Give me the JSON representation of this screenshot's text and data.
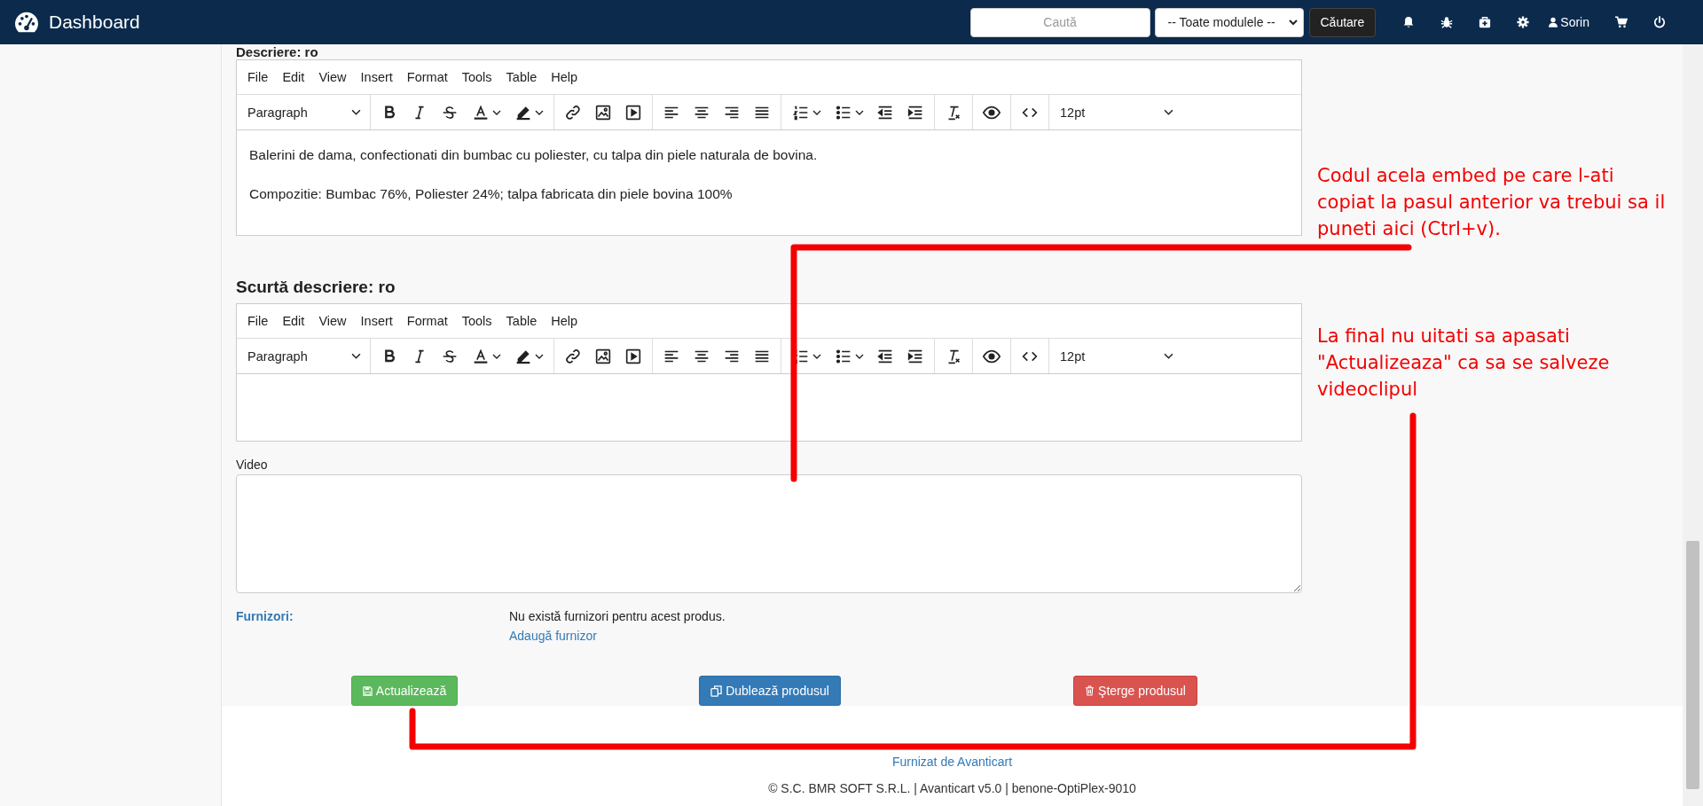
{
  "navbar": {
    "brand": "Dashboard",
    "search": {
      "placeholder": "Caută"
    },
    "module_select": {
      "value": "-- Toate modulele --"
    },
    "search_button": "Căutare",
    "user": "Sorin"
  },
  "editors": [
    {
      "heading": "Descriere: ro",
      "menu": [
        "File",
        "Edit",
        "View",
        "Insert",
        "Format",
        "Tools",
        "Table",
        "Help"
      ],
      "block_format": "Paragraph",
      "font_size": "12pt",
      "paragraphs": [
        "Balerini de dama, confectionati din bumbac cu poliester, cu talpa din piele naturala de bovina.",
        "Compozitie: Bumbac 76%, Poliester 24%; talpa fabricata din piele bovina 100%"
      ]
    },
    {
      "heading": "Scurtă descriere: ro",
      "menu": [
        "File",
        "Edit",
        "View",
        "Insert",
        "Format",
        "Tools",
        "Table",
        "Help"
      ],
      "block_format": "Paragraph",
      "font_size": "12pt"
    }
  ],
  "video": {
    "label": "Video"
  },
  "suppliers": {
    "label": "Furnizori:",
    "empty_text": "Nu există furnizori pentru acest produs.",
    "add_link": "Adaugă furnizor"
  },
  "actions": [
    {
      "label": "Actualizează",
      "kind": "save"
    },
    {
      "label": "Dublează produsul",
      "kind": "duplicate"
    },
    {
      "label": "Şterge produsul",
      "kind": "delete"
    }
  ],
  "footer": {
    "credit": "Furnizat de Avanticart",
    "copyright": "© S.C. BMR SOFT S.R.L. | Avanticart v5.0 | benone-OptiPlex-9010"
  },
  "annotations": [
    {
      "text": "Codul acela embed pe care l-ati copiat la pasul anterior va trebui sa il puneti aici (Ctrl+v)."
    },
    {
      "text": "La final nu uitati sa apasati \"Actualizeaza\" ca sa se salveze videoclipul"
    }
  ]
}
